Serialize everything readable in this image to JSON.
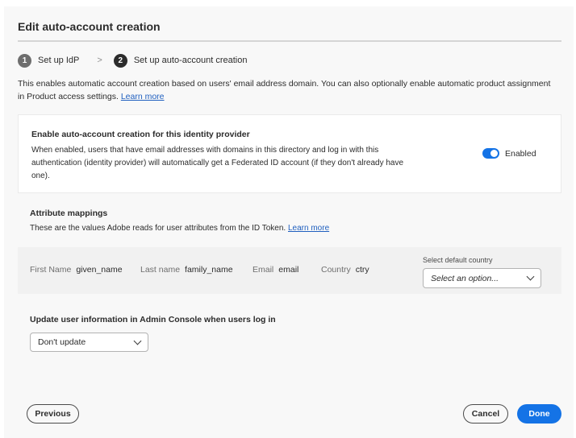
{
  "dialog": {
    "title": "Edit auto-account creation",
    "steps": [
      {
        "number": "1",
        "label": "Set up IdP"
      },
      {
        "number": "2",
        "label": "Set up auto-account creation"
      }
    ],
    "step_separator": ">",
    "intro_text": "This enables automatic account creation based on users' email address domain. You can also optionally enable automatic product assignment in Product access settings.",
    "intro_link": "Learn more"
  },
  "auto_account": {
    "title": "Enable auto-account creation for this identity provider",
    "description": "When enabled, users that have email addresses with domains in this directory and log in with this authentication (identity provider) will automatically get a Federated ID account (if they don't already have one).",
    "toggle_label": "Enabled",
    "toggle_on": true
  },
  "attribute_mappings": {
    "title": "Attribute mappings",
    "subtitle": "These are the values Adobe reads for user attributes from the ID Token.",
    "subtitle_link": "Learn more",
    "mappings": [
      {
        "label": "First Name",
        "value": "given_name"
      },
      {
        "label": "Last name",
        "value": "family_name"
      },
      {
        "label": "Email",
        "value": "email"
      },
      {
        "label": "Country",
        "value": "ctry"
      }
    ],
    "default_country_label": "Select default country",
    "default_country_placeholder": "Select an option..."
  },
  "update_info": {
    "title": "Update user information in Admin Console when users log in",
    "selected": "Don't update"
  },
  "footer": {
    "previous": "Previous",
    "cancel": "Cancel",
    "done": "Done"
  },
  "colors": {
    "accent": "#1473e6",
    "link": "#1f5fbf"
  }
}
